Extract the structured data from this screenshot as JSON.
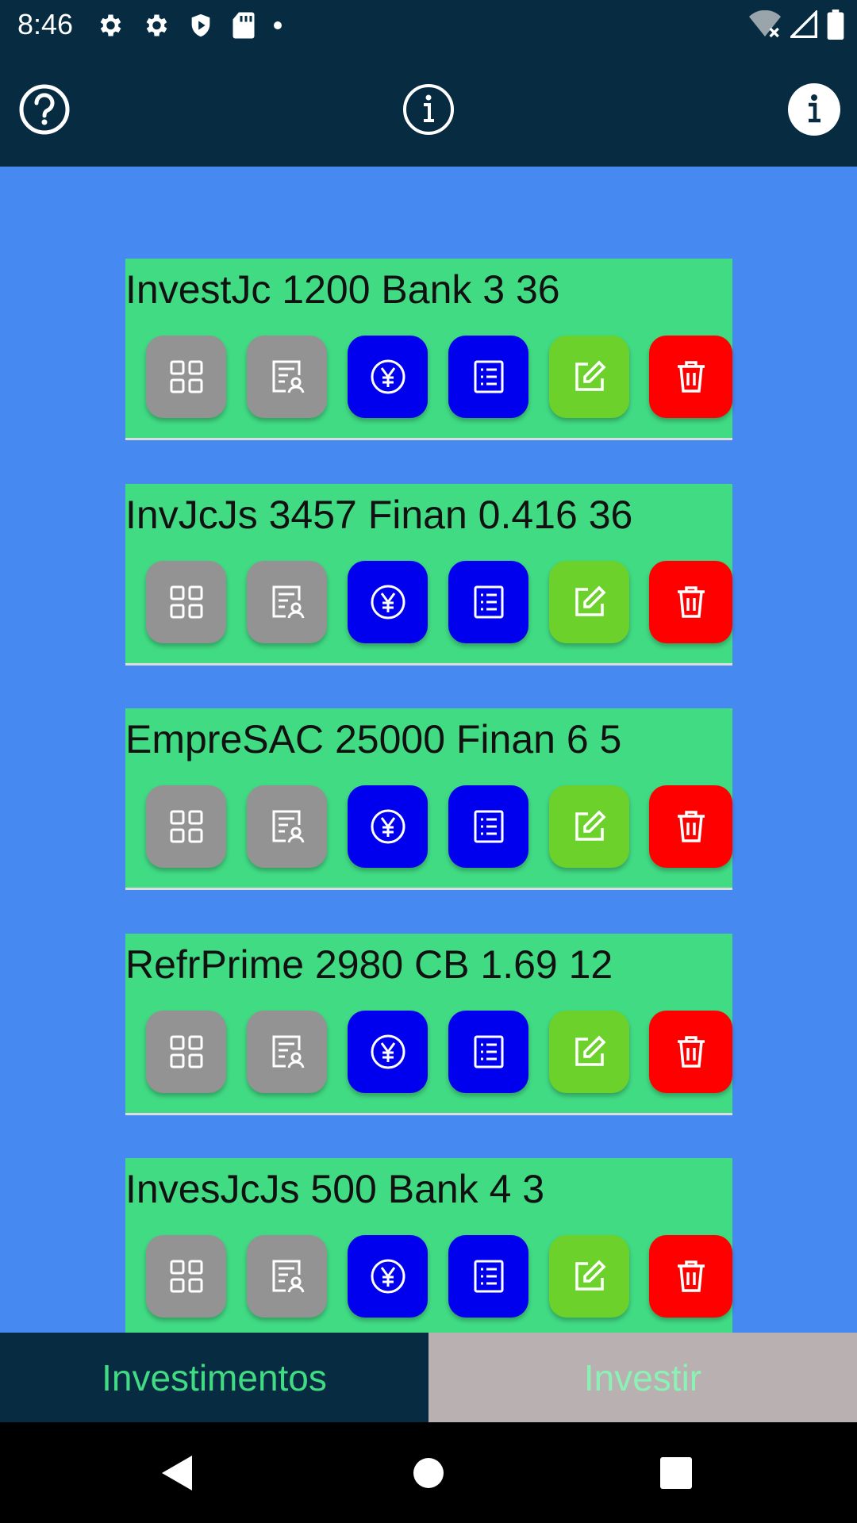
{
  "status_bar": {
    "time": "8:46",
    "left_icons": [
      "gear-icon",
      "gear-icon",
      "shield-icon",
      "sd-card-icon",
      "dot-icon"
    ],
    "right_icons": [
      "wifi-off-icon",
      "signal-icon",
      "battery-icon"
    ]
  },
  "app_bar": {
    "icons": [
      "help-circle-icon",
      "info-circle-icon",
      "info-filled-icon"
    ]
  },
  "investments": [
    {
      "title": "InvestJc 1200 Bank 3 36"
    },
    {
      "title": "InvJcJs 3457 Finan 0.416 36"
    },
    {
      "title": "EmpreSAC 25000 Finan 6 5"
    },
    {
      "title": "RefrPrime 2980 CB 1.69 12"
    },
    {
      "title": "InvesJcJs 500 Bank 4 3"
    }
  ],
  "card_buttons": [
    "grid-icon",
    "report-user-icon",
    "yen-circle-icon",
    "list-icon",
    "edit-icon",
    "trash-icon"
  ],
  "colors": {
    "header": "#072C42",
    "background": "#4589F1",
    "card": "#41DB84",
    "gray_button": "#939393",
    "blue_button": "#0000EE",
    "green_button": "#6CD12A",
    "red_button": "#FF0000"
  },
  "tabs": [
    {
      "label": "Investimentos",
      "selected": true
    },
    {
      "label": "Investir",
      "selected": false
    }
  ],
  "nav_bar": [
    "back-icon",
    "home-icon",
    "recents-icon"
  ]
}
